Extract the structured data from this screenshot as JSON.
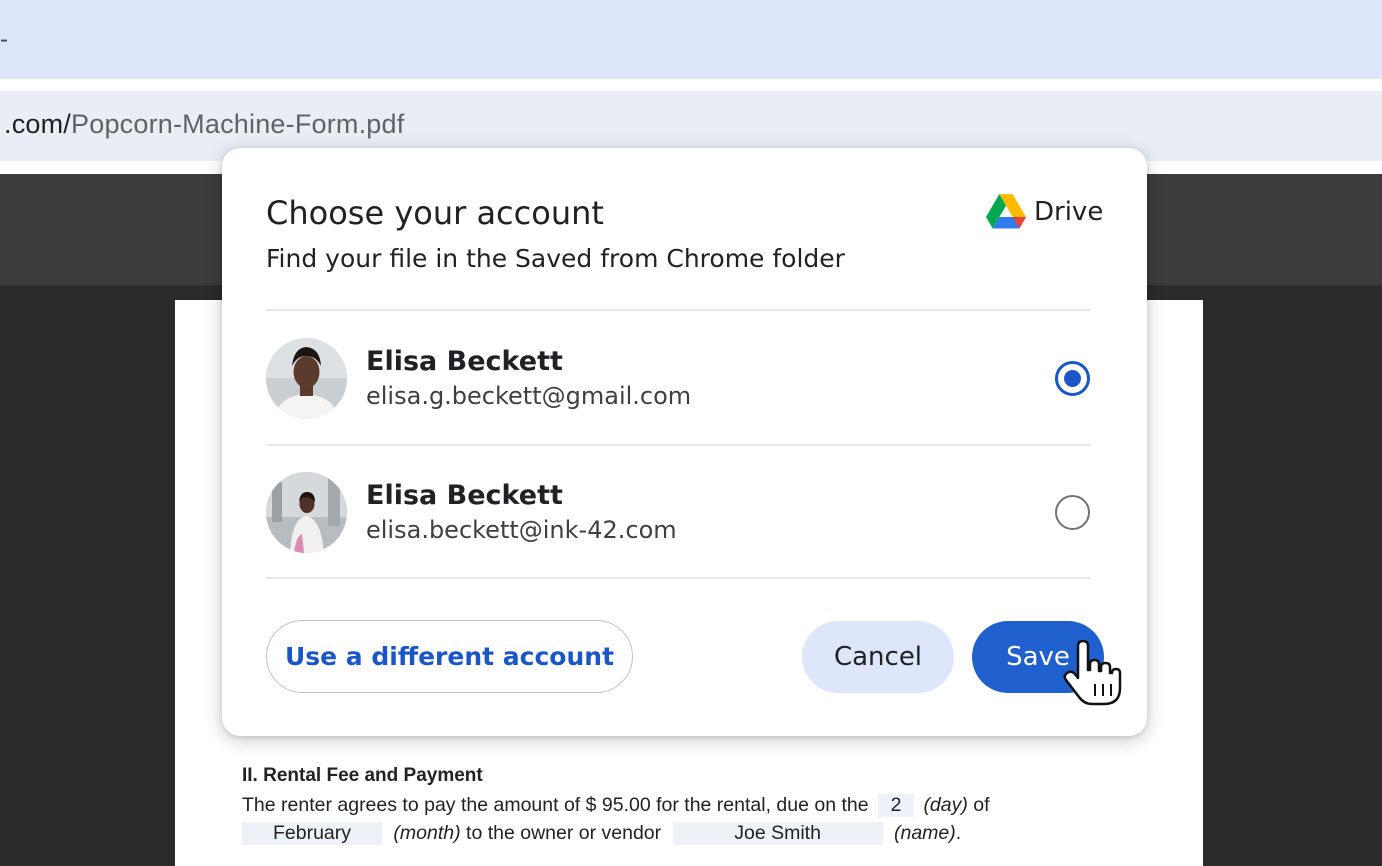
{
  "browser": {
    "tab_edge_text": "-",
    "url_host": ".com/",
    "url_path": "Popcorn-Machine-Form.pdf"
  },
  "dialog": {
    "title": "Choose your account",
    "subtitle": "Find your file in the Saved from Chrome folder",
    "brand_label": "Drive",
    "accounts": [
      {
        "name": "Elisa Beckett",
        "email": "elisa.g.beckett@gmail.com",
        "selected": true
      },
      {
        "name": "Elisa Beckett",
        "email": "elisa.beckett@ink-42.com",
        "selected": false
      }
    ],
    "buttons": {
      "different_account": "Use a different account",
      "cancel": "Cancel",
      "save": "Save"
    }
  },
  "document": {
    "heading": "II. Rental Fee and Payment",
    "line1_prefix": "The renter agrees to pay the amount of $ 95.00 for the rental, due on the",
    "day_value": "2",
    "day_label": "(day)",
    "line1_suffix": "of",
    "month_value": "February",
    "month_label": "(month)",
    "line2_middle": "to the owner or vendor",
    "name_value": "Joe Smith",
    "name_label": "(name)",
    "line2_end": "."
  },
  "colors": {
    "accent": "#1f5fce",
    "selected_radio": "#1a56c7",
    "cancel_bg": "#dde6fa",
    "tabstrip_bg": "#dde6fb"
  },
  "icons": [
    "google-drive-icon",
    "hand-pointer-cursor-icon"
  ]
}
